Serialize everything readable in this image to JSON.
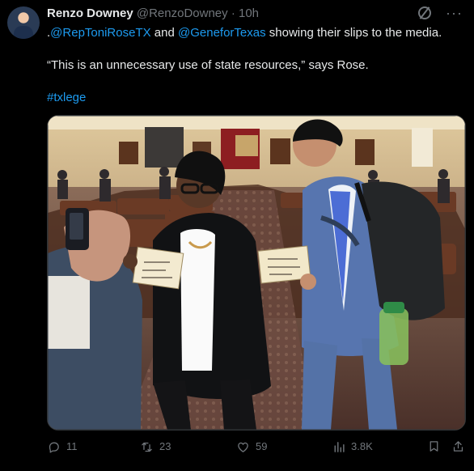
{
  "tweet": {
    "author_name": "Renzo Downey",
    "author_handle": "@RenzoDowney",
    "separator": "·",
    "time": "10h",
    "text_prefix": ".",
    "mention_1": "@RepToniRoseTX",
    "text_and": " and ",
    "mention_2": "@GeneforTexas",
    "text_rest": " showing their slips to the media.",
    "quote": "“This is an unnecessary use of state resources,” says Rose.",
    "hashtag": "#txlege"
  },
  "actions": {
    "replies": "11",
    "reposts": "23",
    "likes": "59",
    "views": "3.8K"
  },
  "icons": {
    "grok": "grok-icon",
    "more": "more-icon",
    "reply": "reply-icon",
    "repost": "repost-icon",
    "like": "heart-icon",
    "views": "views-icon",
    "bookmark": "bookmark-icon",
    "share": "share-icon"
  }
}
